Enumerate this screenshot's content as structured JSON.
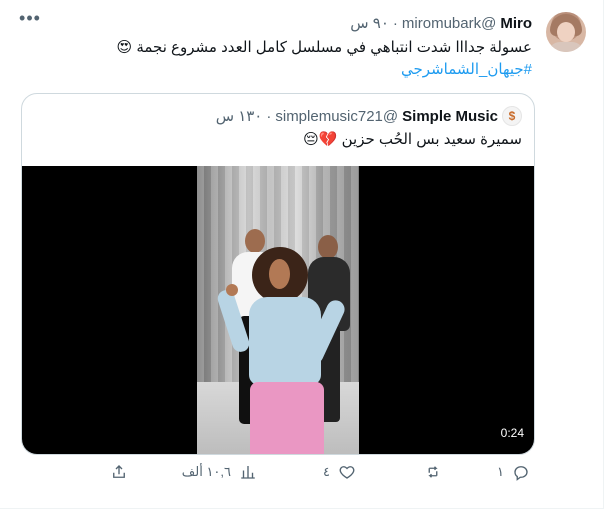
{
  "tweet": {
    "author_name": "Miro",
    "author_handle": "@miromubark",
    "separator": "·",
    "timestamp": "٩٠ س",
    "text_line_1": "عسولة جدااا شدت انتباهي في مسلسل كامل العدد مشروع نجمة 😍",
    "hashtag": "#جيهان_الشماشرجي"
  },
  "quote": {
    "author_name": "Simple Music",
    "author_handle": "@simplemusic721",
    "separator": "·",
    "timestamp": "١٣٠ س",
    "text": "سميرة سعيد بس الحُب حزين 💔😔",
    "avatar_symbol": "$",
    "video_duration": "0:24"
  },
  "actions": {
    "reply_count": "١",
    "retweet_count": "",
    "like_count": "٤",
    "views_count": "١٠,٦ ألف",
    "share_label": ""
  },
  "icons": {
    "more": "more-icon",
    "reply": "reply-icon",
    "retweet": "retweet-icon",
    "like": "heart-icon",
    "views": "views-icon",
    "share": "share-icon"
  },
  "colors": {
    "text": "#0f1419",
    "muted": "#536471",
    "link": "#1d9bf0",
    "border": "#cfd9de",
    "video_bg": "#000000"
  }
}
